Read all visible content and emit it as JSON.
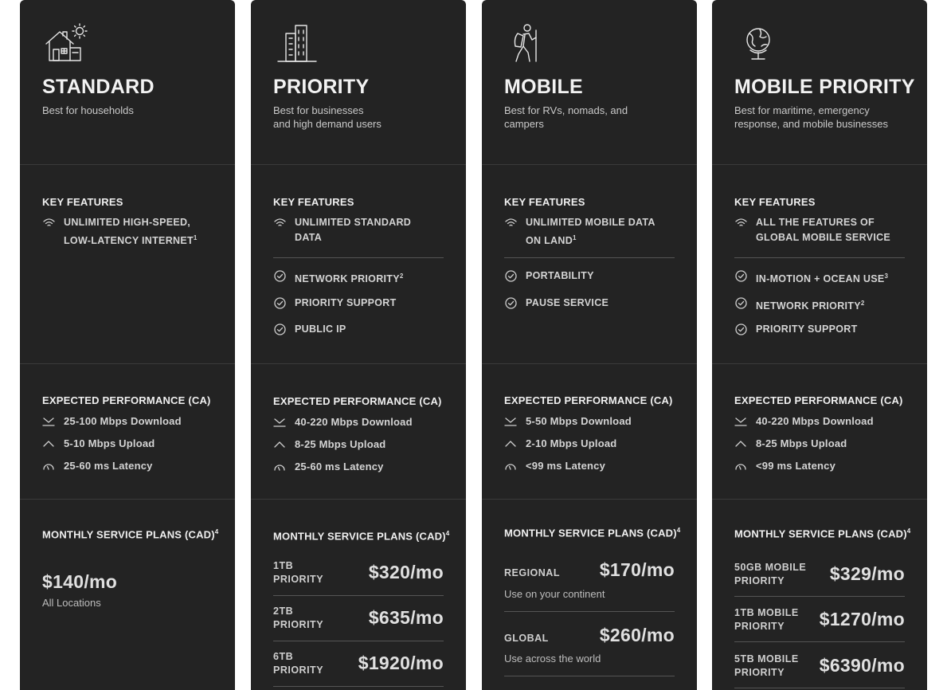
{
  "section_titles": {
    "key_features": "KEY FEATURES",
    "expected_performance": "EXPECTED PERFORMANCE (CA)",
    "monthly_plans": "MONTHLY SERVICE PLANS (CAD)",
    "monthly_plans_footnote": "4"
  },
  "icons": {
    "standard": "house-sun-icon",
    "priority": "building-icon",
    "mobile": "hiker-icon",
    "mobile_priority": "globe-icon",
    "wifi": "wifi-icon",
    "check": "check-circle-icon",
    "download": "download-icon",
    "upload": "upload-chevron-icon",
    "latency": "gauge-icon"
  },
  "colors": {
    "card_bg": "#232323",
    "page_bg": "#ffffff",
    "divider": "#555555"
  },
  "plans": [
    {
      "name": "STANDARD",
      "subtitle_lines": [
        "Best for households"
      ],
      "features": [
        {
          "text_lines": [
            "UNLIMITED HIGH-SPEED,",
            "LOW-LATENCY INTERNET"
          ],
          "footnote": "1",
          "icon": "wifi"
        }
      ],
      "performance": {
        "download": "25-100 Mbps Download",
        "upload": "5-10 Mbps Upload",
        "latency": "25-60 ms Latency"
      },
      "pricing": {
        "price": "$140/mo",
        "note": "All Locations"
      }
    },
    {
      "name": "PRIORITY",
      "subtitle_lines": [
        "Best for businesses",
        "and high demand users"
      ],
      "features": [
        {
          "text_lines": [
            "UNLIMITED STANDARD",
            "DATA"
          ],
          "footnote": "",
          "icon": "wifi"
        },
        {
          "text_lines": [
            "NETWORK PRIORITY"
          ],
          "footnote": "2",
          "icon": "check"
        },
        {
          "text_lines": [
            "PRIORITY SUPPORT"
          ],
          "footnote": "",
          "icon": "check"
        },
        {
          "text_lines": [
            "PUBLIC IP"
          ],
          "footnote": "",
          "icon": "check"
        }
      ],
      "performance": {
        "download": "40-220 Mbps Download",
        "upload": "8-25 Mbps Upload",
        "latency": "25-60 ms Latency"
      },
      "tiers": [
        {
          "label_lines": [
            "1TB",
            "PRIORITY"
          ],
          "price": "$320/mo"
        },
        {
          "label_lines": [
            "2TB",
            "PRIORITY"
          ],
          "price": "$635/mo"
        },
        {
          "label_lines": [
            "6TB",
            "PRIORITY"
          ],
          "price": "$1920/mo"
        }
      ]
    },
    {
      "name": "MOBILE",
      "subtitle_lines": [
        "Best for RVs, nomads, and",
        "campers"
      ],
      "features": [
        {
          "text_lines": [
            "UNLIMITED MOBILE DATA",
            "ON LAND"
          ],
          "footnote": "1",
          "icon": "wifi"
        },
        {
          "text_lines": [
            "PORTABILITY"
          ],
          "footnote": "",
          "icon": "check"
        },
        {
          "text_lines": [
            "PAUSE SERVICE"
          ],
          "footnote": "",
          "icon": "check"
        }
      ],
      "performance": {
        "download": "5-50 Mbps Download",
        "upload": "2-10 Mbps Upload",
        "latency": "<99 ms Latency"
      },
      "tiers": [
        {
          "label": "REGIONAL",
          "price": "$170/mo",
          "note": "Use on your continent"
        },
        {
          "label": "GLOBAL",
          "price": "$260/mo",
          "note": "Use across the world"
        }
      ]
    },
    {
      "name": "MOBILE PRIORITY",
      "subtitle_lines": [
        "Best for maritime, emergency",
        "response, and mobile businesses"
      ],
      "features": [
        {
          "text_lines": [
            "ALL THE FEATURES OF",
            "GLOBAL MOBILE SERVICE"
          ],
          "footnote": "",
          "icon": "wifi"
        },
        {
          "text_lines": [
            "IN-MOTION + OCEAN USE"
          ],
          "footnote": "3",
          "icon": "check"
        },
        {
          "text_lines": [
            "NETWORK PRIORITY"
          ],
          "footnote": "2",
          "icon": "check"
        },
        {
          "text_lines": [
            "PRIORITY SUPPORT"
          ],
          "footnote": "",
          "icon": "check"
        }
      ],
      "performance": {
        "download": "40-220 Mbps Download",
        "upload": "8-25 Mbps Upload",
        "latency": "<99 ms Latency"
      },
      "tiers": [
        {
          "label_lines": [
            "50GB MOBILE",
            "PRIORITY"
          ],
          "price": "$329/mo"
        },
        {
          "label_lines": [
            "1TB MOBILE",
            "PRIORITY"
          ],
          "price": "$1270/mo"
        },
        {
          "label_lines": [
            "5TB MOBILE",
            "PRIORITY"
          ],
          "price": "$6390/mo"
        }
      ]
    }
  ]
}
